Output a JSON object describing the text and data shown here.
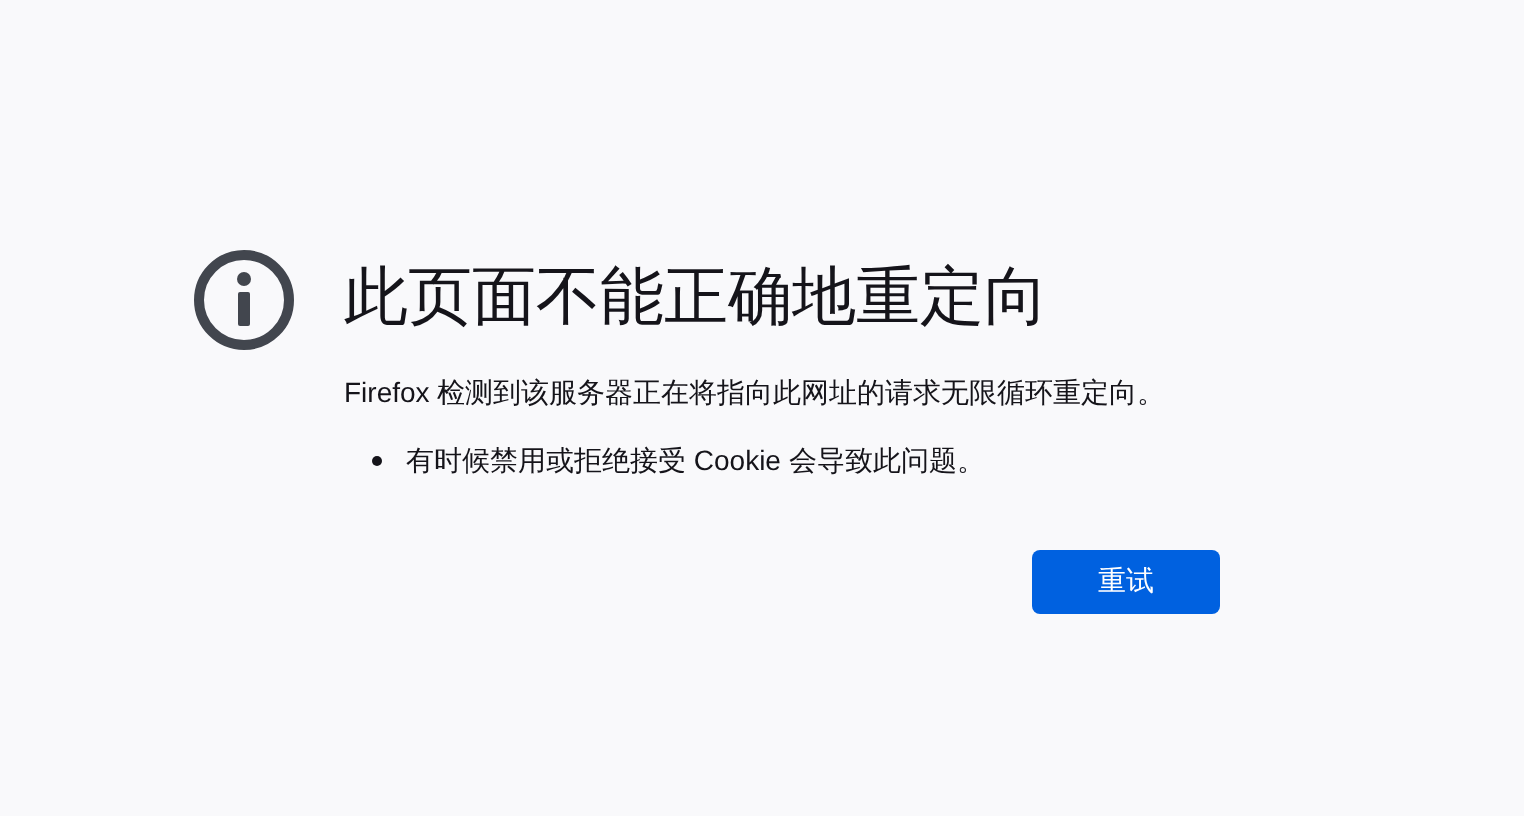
{
  "title": "此页面不能正确地重定向",
  "description": "Firefox 检测到该服务器正在将指向此网址的请求无限循环重定向。",
  "bullets": [
    "有时候禁用或拒绝接受 Cookie 会导致此问题。"
  ],
  "buttons": [
    "重试"
  ]
}
